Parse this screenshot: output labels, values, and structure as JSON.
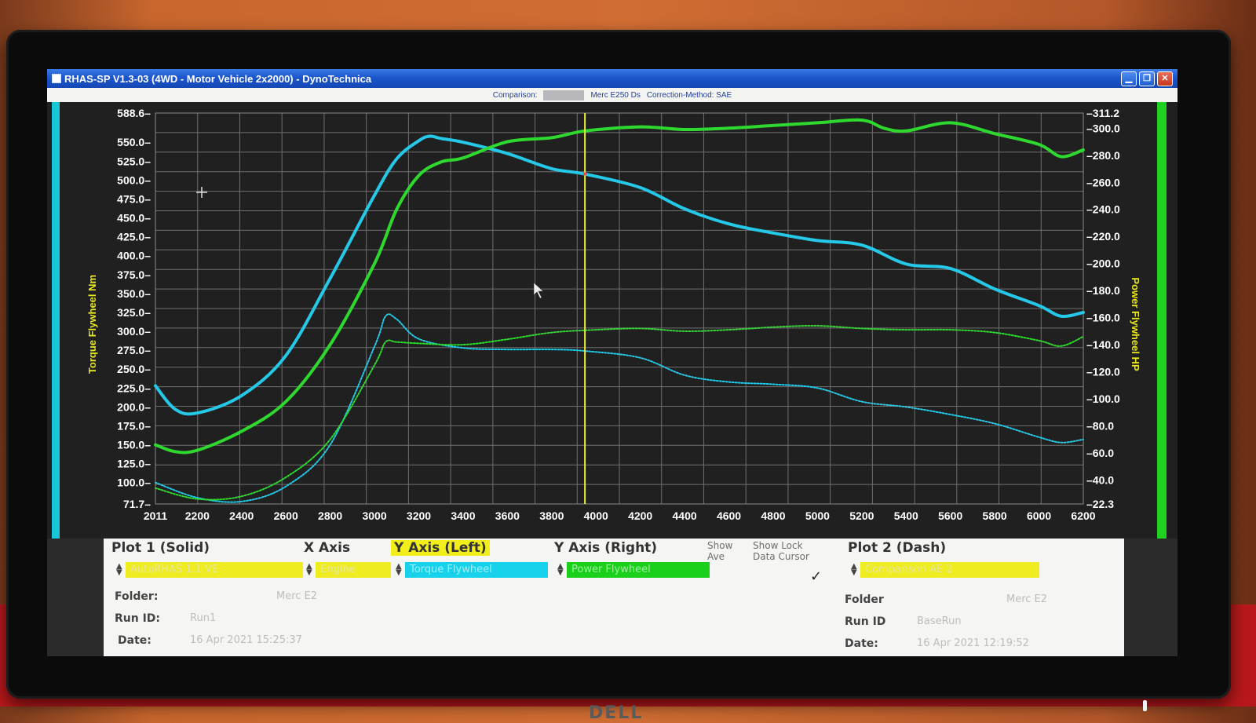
{
  "window": {
    "title": "RHAS-SP V1.3-03  (4WD - Motor Vehicle 2x2000) - DynoTechnica",
    "comparison_label": "Comparison:",
    "comparison_value": "Merc E250 Ds",
    "correction_label": "Correction-Method: SAE"
  },
  "monitor": {
    "brand": "DELL"
  },
  "colors": {
    "torque": "#25c8e6",
    "power": "#2fd82f",
    "cursor": "#ecec3a",
    "left_bar": "#19c8d6",
    "right_bar": "#22d022",
    "plot_bg": "#202020",
    "grid": "#6f6f6f"
  },
  "chart_data": {
    "type": "line",
    "xlabel": "",
    "xticks": [
      2011,
      2200,
      2400,
      2600,
      2800,
      3000,
      3200,
      3400,
      3600,
      3800,
      4000,
      4200,
      4400,
      4600,
      4800,
      5000,
      5200,
      5400,
      5600,
      5800,
      6000,
      6200
    ],
    "xlim": [
      2011,
      6200
    ],
    "ylabel_left": "Torque Flywheel Nm",
    "ylim_left": [
      71.7,
      588.6
    ],
    "yticks_left": [
      "588.6",
      "550.0",
      "525.0",
      "500.0",
      "475.0",
      "450.0",
      "425.0",
      "400.0",
      "375.0",
      "350.0",
      "325.0",
      "300.0",
      "275.0",
      "250.0",
      "225.0",
      "200.0",
      "175.0",
      "150.0",
      "125.0",
      "100.0",
      "71.7"
    ],
    "ylabel_right": "Power Flywheel HP",
    "ylim_right": [
      22.3,
      311.2
    ],
    "yticks_right": [
      "311.2",
      "300.0",
      "280.0",
      "260.0",
      "240.0",
      "220.0",
      "200.0",
      "180.0",
      "160.0",
      "140.0",
      "120.0",
      "100.0",
      "80.0",
      "60.0",
      "40.0",
      "22.3"
    ],
    "cursor_x": 3950,
    "grid": true,
    "series": [
      {
        "name": "Torque Flywheel",
        "axis": "left",
        "style": "solid",
        "plot": "Plot 1",
        "x": [
          2011,
          2100,
          2200,
          2400,
          2600,
          2800,
          3000,
          3100,
          3200,
          3250,
          3300,
          3400,
          3600,
          3800,
          3950,
          4200,
          4400,
          4600,
          4800,
          5000,
          5200,
          5400,
          5600,
          5800,
          6000,
          6100,
          6200
        ],
        "y": [
          228,
          197,
          192,
          215,
          268,
          370,
          480,
          528,
          552,
          558,
          555,
          550,
          535,
          515,
          508,
          490,
          462,
          442,
          430,
          420,
          414,
          389,
          383,
          356,
          334,
          320,
          325
        ]
      },
      {
        "name": "Power Flywheel",
        "axis": "right",
        "style": "solid",
        "plot": "Plot 1",
        "x": [
          2011,
          2100,
          2200,
          2400,
          2600,
          2800,
          3000,
          3100,
          3200,
          3300,
          3400,
          3600,
          3800,
          3950,
          4200,
          4400,
          4600,
          4800,
          5000,
          5200,
          5300,
          5400,
          5600,
          5800,
          6000,
          6100,
          6200
        ],
        "y": [
          66,
          61,
          62,
          76,
          98,
          140,
          200,
          240,
          265,
          275,
          278,
          290,
          293,
          298,
          301,
          299,
          300,
          302,
          304,
          306,
          300,
          298,
          304,
          296,
          288,
          279,
          284
        ]
      },
      {
        "name": "Comparison Torque",
        "axis": "left",
        "style": "dash",
        "plot": "Plot 2",
        "x": [
          2011,
          2200,
          2400,
          2600,
          2800,
          3000,
          3050,
          3100,
          3200,
          3400,
          3600,
          3800,
          3950,
          4200,
          4400,
          4600,
          4800,
          5000,
          5200,
          5400,
          5600,
          5800,
          6000,
          6100,
          6200
        ],
        "y": [
          100,
          80,
          75,
          95,
          150,
          280,
          320,
          316,
          290,
          278,
          276,
          276,
          274,
          265,
          242,
          233,
          230,
          225,
          207,
          200,
          190,
          178,
          160,
          153,
          157
        ]
      },
      {
        "name": "Comparison Power",
        "axis": "right",
        "style": "dash",
        "plot": "Plot 2",
        "x": [
          2011,
          2200,
          2400,
          2600,
          2800,
          3000,
          3050,
          3100,
          3200,
          3400,
          3600,
          3800,
          4000,
          4200,
          4400,
          4600,
          4800,
          5000,
          5200,
          5400,
          5600,
          5800,
          6000,
          6100,
          6200
        ],
        "y": [
          34,
          26,
          28,
          42,
          70,
          125,
          142,
          142,
          141,
          140,
          144,
          149,
          151,
          152,
          150,
          151,
          153,
          154,
          152,
          151,
          151,
          149,
          143,
          139,
          146
        ]
      }
    ]
  },
  "panel": {
    "plot1_header": "Plot 1 (Solid)",
    "x_axis_header": "X Axis",
    "y_left_header": "Y Axis (Left)",
    "y_right_header": "Y Axis (Right)",
    "show_ave": "Show\nAve",
    "show_data_cursor": "Show Lock\nData Cursor",
    "plot2_header": "Plot 2 (Dash)",
    "plot1_select": "AutoRHAS 1.1 VE",
    "x_axis_select": "Engine",
    "y_left_select": "Torque Flywheel",
    "y_right_select": "Power Flywheel",
    "plot2_select": "Comparison AE 2",
    "check_mark": "✓",
    "plot1_info": {
      "folder_label": "Folder:",
      "folder_value": "Merc E2",
      "runid_label": "Run ID:",
      "runid_value": "Run1",
      "date_label": "Date:",
      "date_value": "16 Apr 2021  15:25:37"
    },
    "plot2_info": {
      "folder_label": "Folder",
      "folder_value": "Merc E2",
      "runid_label": "Run ID",
      "runid_value": "BaseRun",
      "date_label": "Date:",
      "date_value": "16 Apr 2021  12:19:52"
    }
  }
}
